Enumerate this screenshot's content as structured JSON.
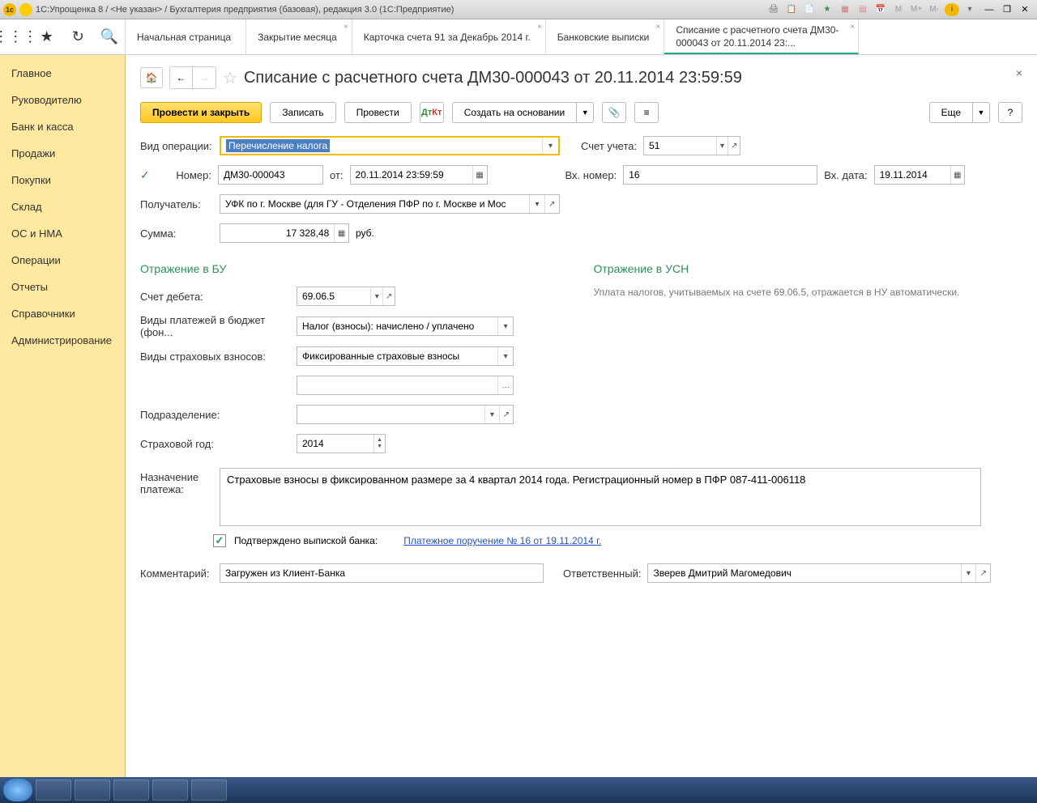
{
  "titlebar": {
    "text": "1С:Упрощенка 8 / <Не указан> / Бухгалтерия предприятия (базовая), редакция 3.0  (1С:Предприятие)",
    "m_labels": [
      "M",
      "M+",
      "M-"
    ]
  },
  "tabs": [
    {
      "label": "Начальная страница",
      "closable": false
    },
    {
      "label": "Закрытие месяца",
      "closable": true
    },
    {
      "label": "Карточка счета 91 за Декабрь 2014 г.",
      "closable": true
    },
    {
      "label": "Банковские выписки",
      "closable": true
    },
    {
      "label": "Списание с расчетного счета ДМ30-000043 от 20.11.2014 23:...",
      "closable": true,
      "active": true
    }
  ],
  "sidebar": [
    "Главное",
    "Руководителю",
    "Банк и касса",
    "Продажи",
    "Покупки",
    "Склад",
    "ОС и НМА",
    "Операции",
    "Отчеты",
    "Справочники",
    "Администрирование"
  ],
  "page": {
    "title": "Списание с расчетного счета ДМ30-000043 от 20.11.2014 23:59:59"
  },
  "toolbar": {
    "post_close": "Провести и закрыть",
    "save": "Записать",
    "post": "Провести",
    "create_based": "Создать на основании",
    "more": "Еще",
    "help": "?"
  },
  "labels": {
    "operation_type": "Вид операции:",
    "account": "Счет учета:",
    "number": "Номер:",
    "from": "от:",
    "in_number": "Вх. номер:",
    "in_date": "Вх. дата:",
    "recipient": "Получатель:",
    "sum": "Сумма:",
    "rub": "руб.",
    "section_bu": "Отражение в БУ",
    "section_usn": "Отражение в УСН",
    "usn_hint": "Уплата налогов, учитываемых на счете 69.06.5, отражается в НУ автоматически.",
    "debit_account": "Счет дебета:",
    "payment_types": "Виды платежей в бюджет (фон...",
    "insurance_types": "Виды страховых взносов:",
    "subdivision": "Подразделение:",
    "insurance_year": "Страховой год:",
    "purpose": "Назначение платежа:",
    "confirmed": "Подтверждено выпиской банка:",
    "link": "Платежное поручение № 16 от 19.11.2014 г.",
    "comment": "Комментарий:",
    "responsible": "Ответственный:"
  },
  "values": {
    "operation_type": "Перечисление налога",
    "account": "51",
    "number": "ДМ30-000043",
    "date_from": "20.11.2014 23:59:59",
    "in_number": "16",
    "in_date": "19.11.2014",
    "recipient": "УФК по г. Москве (для ГУ - Отделения ПФР по г. Москве и Мос",
    "sum": "17 328,48",
    "debit_account": "69.06.5",
    "payment_types": "Налог (взносы): начислено / уплачено",
    "insurance_types": "Фиксированные страховые взносы",
    "subdivision": "",
    "insurance_year": "2014",
    "purpose": "Страховые взносы в фиксированном размере за 4 квартал 2014 года. Регистрационный номер в ПФР 087-411-006118",
    "comment": "Загружен из Клиент-Банка",
    "responsible": "Зверев Дмитрий Магомедович"
  }
}
